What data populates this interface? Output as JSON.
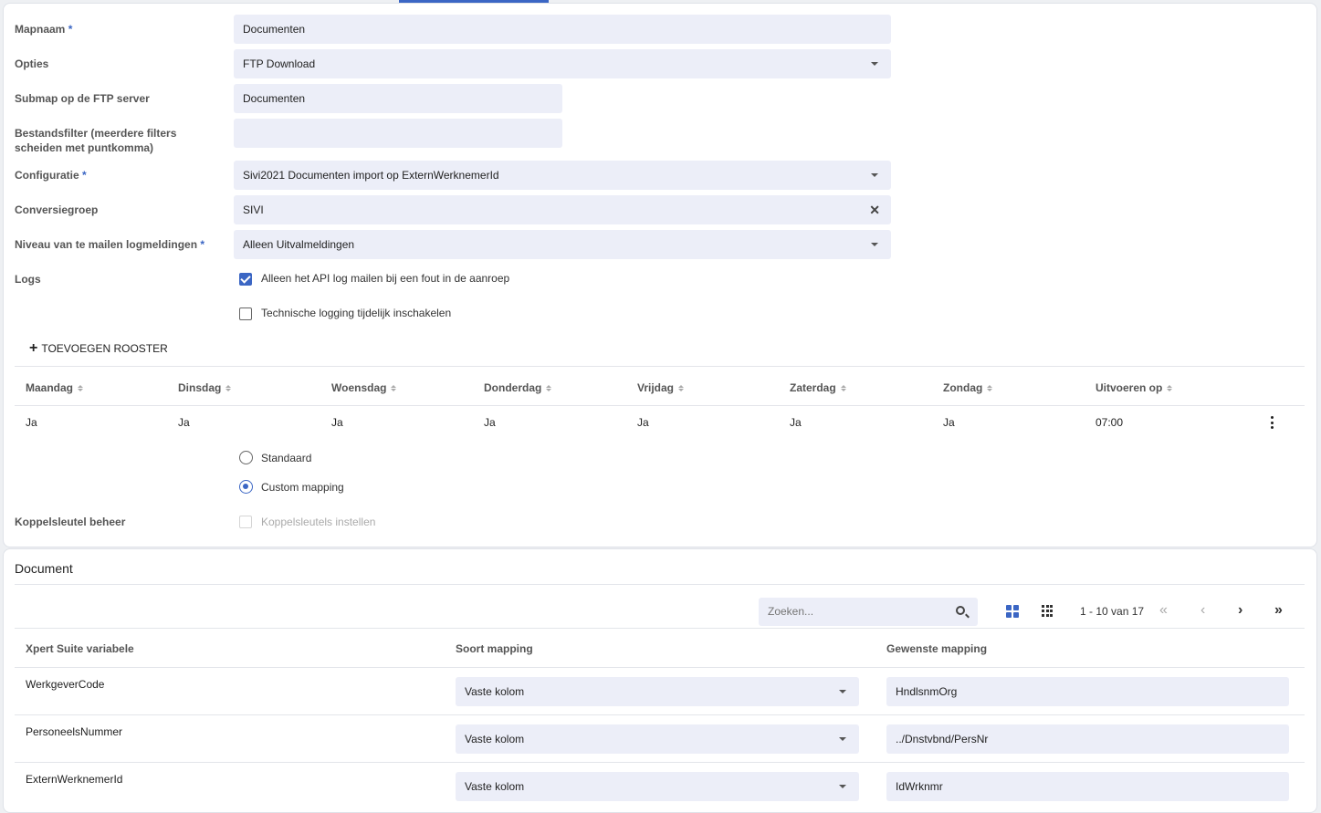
{
  "form": {
    "mapnaam": {
      "label": "Mapnaam",
      "value": "Documenten"
    },
    "opties": {
      "label": "Opties",
      "value": "FTP Download"
    },
    "submap": {
      "label": "Submap op de FTP server",
      "value": "Documenten"
    },
    "bestandsfilter": {
      "label_line1": "Bestandsfilter (meerdere filters",
      "label_line2": "scheiden met puntkomma)",
      "value": ""
    },
    "configuratie": {
      "label": "Configuratie",
      "value": "Sivi2021 Documenten import op ExternWerknemerId"
    },
    "conversiegroep": {
      "label": "Conversiegroep",
      "value": "SIVI"
    },
    "niveau": {
      "label": "Niveau van te mailen logmeldingen",
      "value": "Alleen Uitvalmeldingen"
    },
    "logs": {
      "label": "Logs",
      "opt1": "Alleen het API log mailen bij een fout in de aanroep",
      "opt2": "Technische logging tijdelijk inschakelen"
    },
    "required_mark": "*"
  },
  "rooster": {
    "add_label": "TOEVOEGEN ROOSTER",
    "headers": [
      "Maandag",
      "Dinsdag",
      "Woensdag",
      "Donderdag",
      "Vrijdag",
      "Zaterdag",
      "Zondag",
      "Uitvoeren op"
    ],
    "row": [
      "Ja",
      "Ja",
      "Ja",
      "Ja",
      "Ja",
      "Ja",
      "Ja",
      "07:00"
    ]
  },
  "mapping_mode": {
    "opt1": "Standaard",
    "opt2": "Custom mapping",
    "selected": "Custom mapping"
  },
  "koppelsleutel": {
    "label": "Koppelsleutel beheer",
    "option": "Koppelsleutels instellen"
  },
  "document": {
    "title": "Document",
    "search_placeholder": "Zoeken...",
    "pager": "1 - 10 van 17",
    "headers": [
      "Xpert Suite variabele",
      "Soort mapping",
      "Gewenste mapping"
    ],
    "rows": [
      {
        "variabele": "WerkgeverCode",
        "soort": "Vaste kolom",
        "gewenst": "HndlsnmOrg"
      },
      {
        "variabele": "PersoneelsNummer",
        "soort": "Vaste kolom",
        "gewenst": "../Dnstvbnd/PersNr"
      },
      {
        "variabele": "ExternWerknemerId",
        "soort": "Vaste kolom",
        "gewenst": "IdWrknmr"
      }
    ]
  },
  "colors": {
    "accent": "#3b66c4",
    "field_bg": "#eceef8"
  }
}
